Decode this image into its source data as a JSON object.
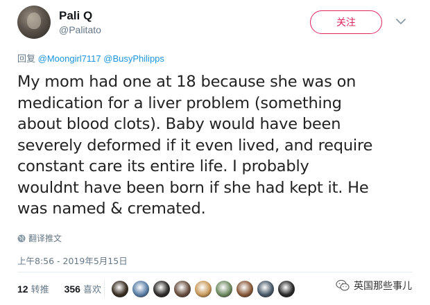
{
  "author": {
    "name": "Pali Q",
    "handle": "@Palitato"
  },
  "follow_label": "关注",
  "reply": {
    "prefix": "回复",
    "mentions": [
      "@Moongirl7117",
      "@BusyPhilipps"
    ]
  },
  "tweet_lines": [
    "My mom had one at 18 because she was on",
    "medication for a liver problem (something",
    "about blood clots). Baby would have been",
    "severely deformed if it even lived, and require",
    "constant care its entire life. I probably",
    "wouldnt have been born if she had kept it. He",
    "was named & cremated."
  ],
  "translate_label": "翻译推文",
  "timestamp": "上午8:56 - 2019年5月15日",
  "stats": {
    "retweets_count": "12",
    "retweets_label": "转推",
    "likes_count": "356",
    "likes_label": "喜欢"
  },
  "liker_avatars": [
    {
      "color": "#3a2f24"
    },
    {
      "color": "#5b7fa8"
    },
    {
      "color": "#2f2c2a"
    },
    {
      "color": "#6a5040"
    },
    {
      "color": "#c99a5c"
    },
    {
      "color": "#6f8b62"
    },
    {
      "color": "#8a5a3a"
    },
    {
      "color": "#4a5a6a"
    },
    {
      "color": "#2a2a2a"
    }
  ],
  "watermark": "英国那些事儿",
  "colors": {
    "accent_red": "#e0245e",
    "link_blue": "#1b95e0",
    "muted": "#657786"
  }
}
